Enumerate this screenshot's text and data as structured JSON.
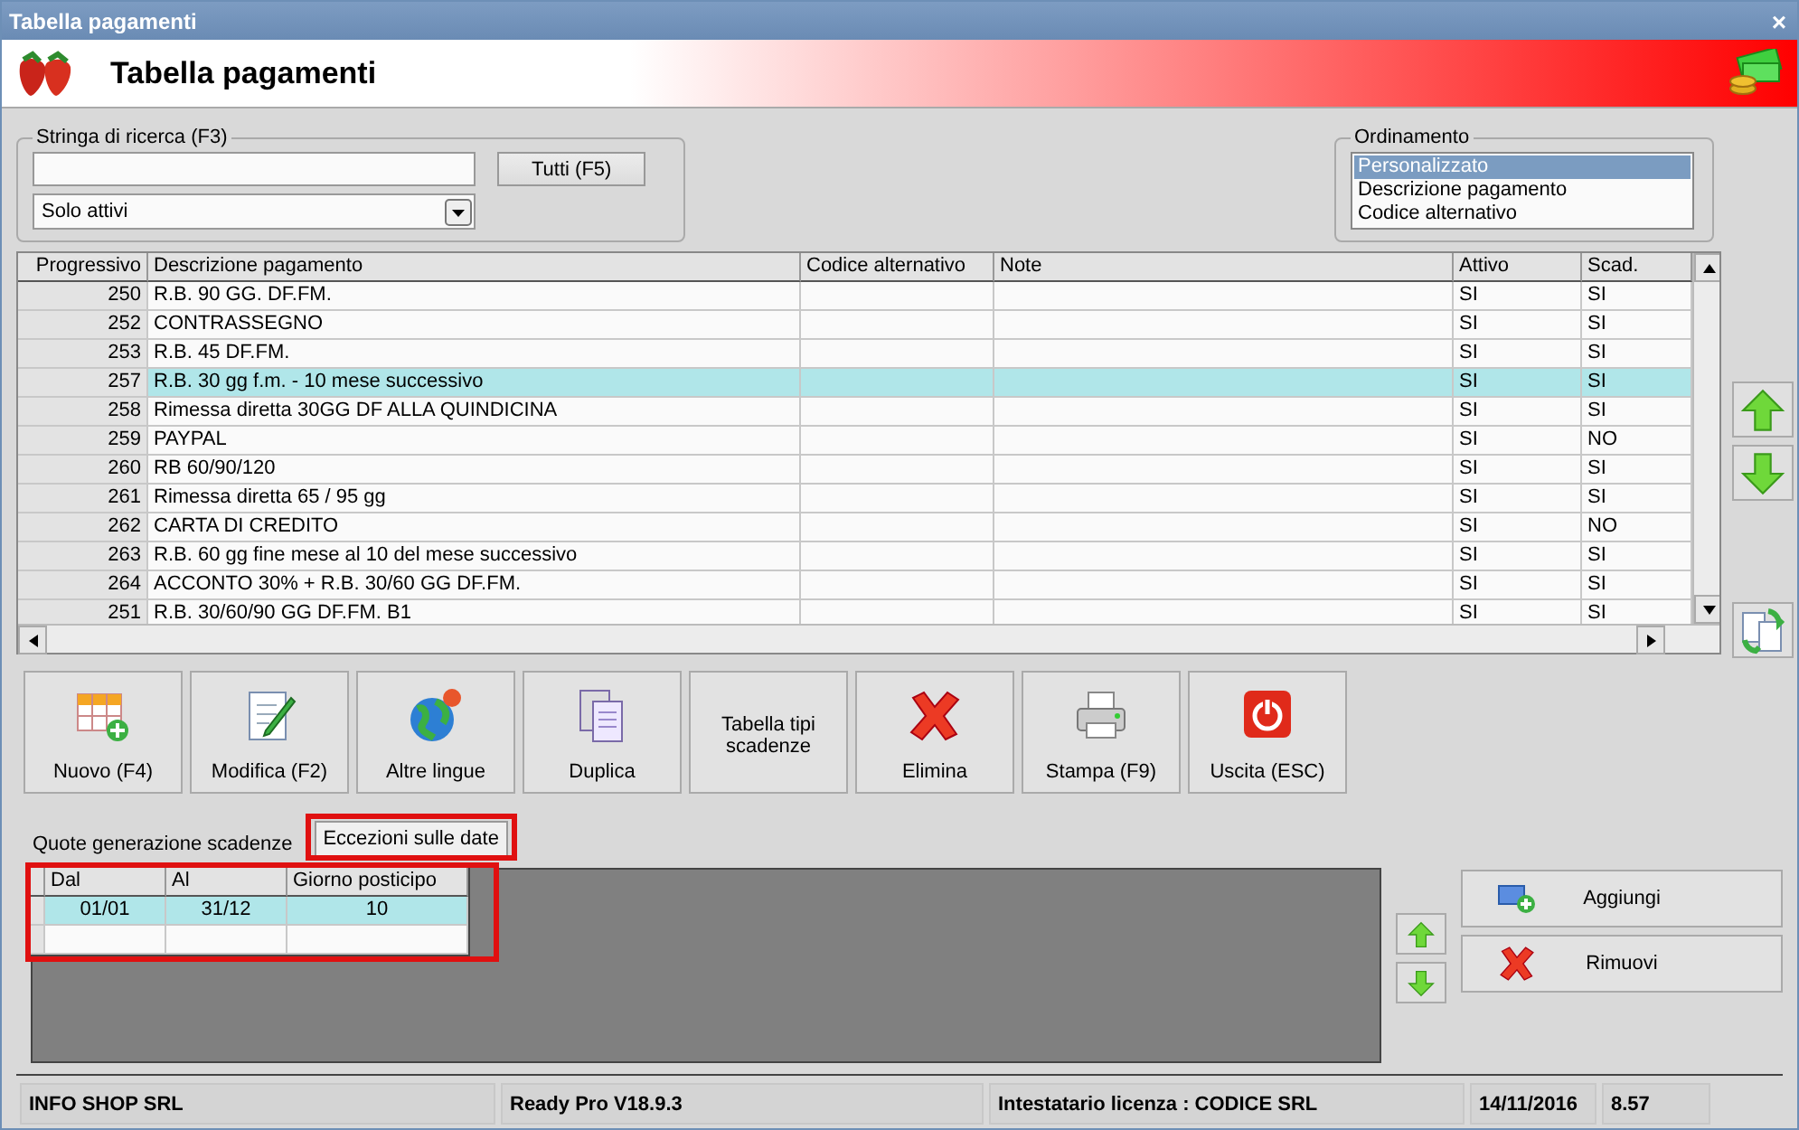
{
  "window": {
    "title": "Tabella pagamenti",
    "close": "×"
  },
  "header": {
    "title": "Tabella pagamenti"
  },
  "search": {
    "legend": "Stringa di ricerca (F3)",
    "all_button": "Tutti (F5)",
    "filter": "Solo attivi"
  },
  "ordering": {
    "legend": "Ordinamento",
    "options": [
      {
        "label": "Personalizzato",
        "selected": true
      },
      {
        "label": "Descrizione pagamento",
        "selected": false
      },
      {
        "label": "Codice alternativo",
        "selected": false
      }
    ]
  },
  "table": {
    "columns": [
      "Progressivo",
      "Descrizione pagamento",
      "Codice alternativo",
      "Note",
      "Attivo",
      "Scad."
    ],
    "rows": [
      {
        "cells": [
          "250",
          "R.B. 90 GG. DF.FM.",
          "",
          "",
          "SI",
          "SI"
        ],
        "selected": false
      },
      {
        "cells": [
          "252",
          "CONTRASSEGNO",
          "",
          "",
          "SI",
          "SI"
        ],
        "selected": false
      },
      {
        "cells": [
          "253",
          "R.B. 45 DF.FM.",
          "",
          "",
          "SI",
          "SI"
        ],
        "selected": false
      },
      {
        "cells": [
          "257",
          "R.B. 30 gg f.m. - 10 mese successivo",
          "",
          "",
          "SI",
          "SI"
        ],
        "selected": true
      },
      {
        "cells": [
          "258",
          "Rimessa diretta 30GG DF ALLA QUINDICINA",
          "",
          "",
          "SI",
          "SI"
        ],
        "selected": false
      },
      {
        "cells": [
          "259",
          "PAYPAL",
          "",
          "",
          "SI",
          "NO"
        ],
        "selected": false
      },
      {
        "cells": [
          "260",
          "RB 60/90/120",
          "",
          "",
          "SI",
          "SI"
        ],
        "selected": false
      },
      {
        "cells": [
          "261",
          "Rimessa diretta 65 / 95 gg",
          "",
          "",
          "SI",
          "SI"
        ],
        "selected": false
      },
      {
        "cells": [
          "262",
          "CARTA DI CREDITO",
          "",
          "",
          "SI",
          "NO"
        ],
        "selected": false
      },
      {
        "cells": [
          "263",
          "R.B. 60 gg fine mese al 10 del mese successivo",
          "",
          "",
          "SI",
          "SI"
        ],
        "selected": false
      },
      {
        "cells": [
          "264",
          "ACCONTO 30% + R.B. 30/60 GG DF.FM.",
          "",
          "",
          "SI",
          "SI"
        ],
        "selected": false
      },
      {
        "cells": [
          "251",
          "R.B. 30/60/90 GG DF.FM. B1",
          "",
          "",
          "SI",
          "SI"
        ],
        "selected": false
      }
    ]
  },
  "toolbar": [
    {
      "label": "Nuovo (F4)",
      "kind": "new"
    },
    {
      "label": "Modifica (F2)",
      "kind": "edit"
    },
    {
      "label": "Altre lingue",
      "kind": "globe"
    },
    {
      "label": "Duplica",
      "kind": "copy"
    },
    {
      "label": "Tabella tipi scadenze",
      "kind": "text"
    },
    {
      "label": "Elimina",
      "kind": "delete"
    },
    {
      "label": "Stampa (F9)",
      "kind": "print"
    },
    {
      "label": "Uscita (ESC)",
      "kind": "exit"
    }
  ],
  "tabs": [
    {
      "label": "Quote generazione scadenze",
      "selected": false
    },
    {
      "label": "Eccezioni sulle date",
      "selected": true
    }
  ],
  "exceptions": {
    "columns": [
      "Dal",
      "Al",
      "Giorno posticipo"
    ],
    "rows": [
      {
        "cells": [
          "01/01",
          "31/12",
          "10"
        ],
        "selected": true
      }
    ]
  },
  "actions": [
    {
      "label": "Aggiungi",
      "kind": "add"
    },
    {
      "label": "Rimuovi",
      "kind": "remove"
    }
  ],
  "status_bar": [
    "INFO SHOP SRL",
    "Ready Pro V18.9.3",
    "Intestatario licenza : CODICE SRL",
    "14/11/2016",
    "8.57"
  ]
}
